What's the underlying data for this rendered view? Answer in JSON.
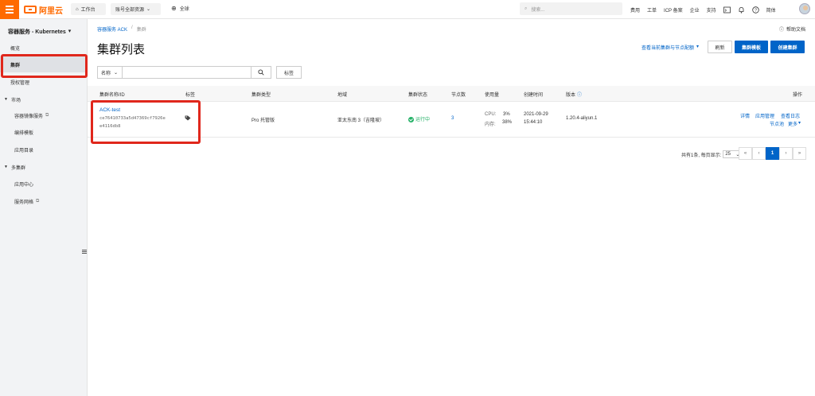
{
  "header": {
    "logo_text": "阿里云",
    "workbench": "工作台",
    "account_scope": "账号全部资源",
    "region": "全球",
    "search_placeholder": "搜索...",
    "links": [
      "费用",
      "工单",
      "ICP 备案",
      "企业",
      "支持"
    ],
    "lang": "简体",
    "accent": "#ff6a00"
  },
  "sidebar": {
    "title": "容器服务 - Kubernetes",
    "items": [
      {
        "label": "概览"
      },
      {
        "label": "集群",
        "active": true
      },
      {
        "label": "授权管理"
      },
      {
        "label": "市场",
        "group": true
      },
      {
        "label": "容器镜像服务",
        "external": true
      },
      {
        "label": "编排模板"
      },
      {
        "label": "应用目录"
      },
      {
        "label": "多集群",
        "group": true
      },
      {
        "label": "应用中心"
      },
      {
        "label": "服务网格",
        "external": true
      }
    ]
  },
  "main": {
    "breadcrumb": [
      "容器服务 ACK",
      "/",
      "集群"
    ],
    "help": "帮助文档",
    "title": "集群列表",
    "quota_link": "查看当前集群与节点配额",
    "refresh": "刷新",
    "template_btn": "集群模板",
    "create_btn": "创建集群",
    "filter_field": "名称",
    "tag_btn": "标签",
    "table": {
      "headers": [
        "集群名称/ID",
        "标签",
        "集群类型",
        "地域",
        "集群状态",
        "节点数",
        "使用量",
        "创建时间",
        "版本",
        "操作"
      ],
      "rows": [
        {
          "name": "ACK-test",
          "id_line1": "ce76410733a5d47369cf7926e",
          "id_line2": "e4116db8",
          "type": "Pro 托管版",
          "region": "亚太东南 3（吉隆坡）",
          "status": "运行中",
          "nodes": "3",
          "cpu_label": "CPU:",
          "cpu": "3%",
          "mem_label": "内存:",
          "mem": "38%",
          "date": "2021-09-29",
          "time": "15:44:10",
          "version": "1.20.4-aliyun.1",
          "actions": [
            "详情",
            "应用管理",
            "查看日志",
            "节点池",
            "更多"
          ]
        }
      ]
    },
    "pager": {
      "summary": "共有1条, 每页显示:",
      "page_size": "25",
      "unit": "条",
      "buttons": [
        "«",
        "‹",
        "1",
        "›",
        "»"
      ],
      "current": "1"
    }
  }
}
